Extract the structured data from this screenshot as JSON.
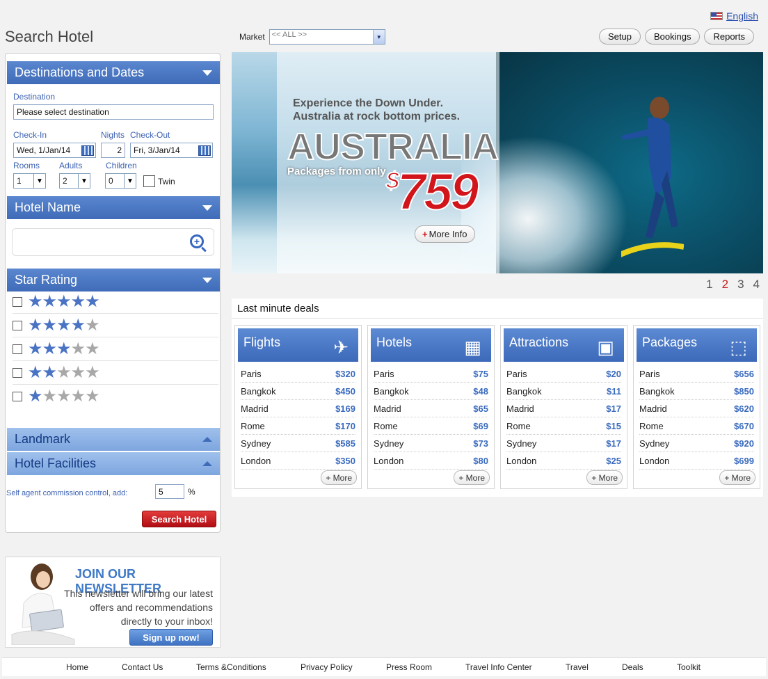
{
  "language": {
    "label": "English"
  },
  "page_title": "Search Hotel",
  "market": {
    "label": "Market",
    "value": "<< ALL >>"
  },
  "top_buttons": [
    "Setup",
    "Bookings",
    "Reports"
  ],
  "search_panel": {
    "destinations": {
      "header": "Destinations and Dates",
      "destination_label": "Destination",
      "destination_value": "Please select destination",
      "checkin_label": "Check-In",
      "checkin_value": "Wed, 1/Jan/14",
      "nights_label": "Nights",
      "nights_value": "2",
      "checkout_label": "Check-Out",
      "checkout_value": "Fri, 3/Jan/14",
      "rooms_label": "Rooms",
      "rooms_value": "1",
      "adults_label": "Adults",
      "adults_value": "2",
      "children_label": "Children",
      "children_value": "0",
      "twin_label": "Twin"
    },
    "hotel_name": {
      "header": "Hotel Name"
    },
    "star_rating": {
      "header": "Star Rating",
      "levels": [
        5,
        4,
        3,
        2,
        1
      ]
    },
    "landmark": {
      "header": "Landmark"
    },
    "hotel_facilities": {
      "header": "Hotel Facilities"
    },
    "commission": {
      "label": "Self agent commission control, add:",
      "value": "5",
      "unit": "%"
    },
    "search_button": "Search Hotel"
  },
  "newsletter": {
    "title": "JOIN OUR NEWSLETTER",
    "line1": "This newsletter will bring our latest",
    "line2": "offers and recommendations",
    "line3": "directly to your inbox!",
    "button": "Sign up now!"
  },
  "banner": {
    "tagline1": "Experience the Down Under.",
    "tagline2": "Australia at rock bottom prices.",
    "headline": "AUSTRALIA",
    "from_text": "Packages from only",
    "price_currency": "$",
    "price_value": "759",
    "more_info": "More Info",
    "pages": [
      "1",
      "2",
      "3",
      "4"
    ],
    "active_page": "2"
  },
  "deals": {
    "title": "Last minute deals",
    "more_label": "More",
    "cards": [
      {
        "name": "Flights",
        "icon": "airplane-icon",
        "glyph": "✈",
        "rows": [
          [
            "Paris",
            "$320"
          ],
          [
            "Bangkok",
            "$450"
          ],
          [
            "Madrid",
            "$169"
          ],
          [
            "Rome",
            "$170"
          ],
          [
            "Sydney",
            "$585"
          ],
          [
            "London",
            "$350"
          ]
        ]
      },
      {
        "name": "Hotels",
        "icon": "hotel-building-icon",
        "glyph": "▦",
        "rows": [
          [
            "Paris",
            "$75"
          ],
          [
            "Bangkok",
            "$48"
          ],
          [
            "Madrid",
            "$65"
          ],
          [
            "Rome",
            "$69"
          ],
          [
            "Sydney",
            "$73"
          ],
          [
            "London",
            "$80"
          ]
        ]
      },
      {
        "name": "Attractions",
        "icon": "photos-icon",
        "glyph": "▣",
        "rows": [
          [
            "Paris",
            "$20"
          ],
          [
            "Bangkok",
            "$11"
          ],
          [
            "Madrid",
            "$17"
          ],
          [
            "Rome",
            "$15"
          ],
          [
            "Sydney",
            "$17"
          ],
          [
            "London",
            "$25"
          ]
        ]
      },
      {
        "name": "Packages",
        "icon": "box-icon",
        "glyph": "⬚",
        "rows": [
          [
            "Paris",
            "$656"
          ],
          [
            "Bangkok",
            "$850"
          ],
          [
            "Madrid",
            "$620"
          ],
          [
            "Rome",
            "$670"
          ],
          [
            "Sydney",
            "$920"
          ],
          [
            "London",
            "$699"
          ]
        ]
      }
    ]
  },
  "footer": [
    "Home",
    "Contact Us",
    "Terms &Conditions",
    "Privacy Policy",
    "Press Room",
    "Travel Info Center",
    "Travel",
    "Deals",
    "Toolkit"
  ]
}
